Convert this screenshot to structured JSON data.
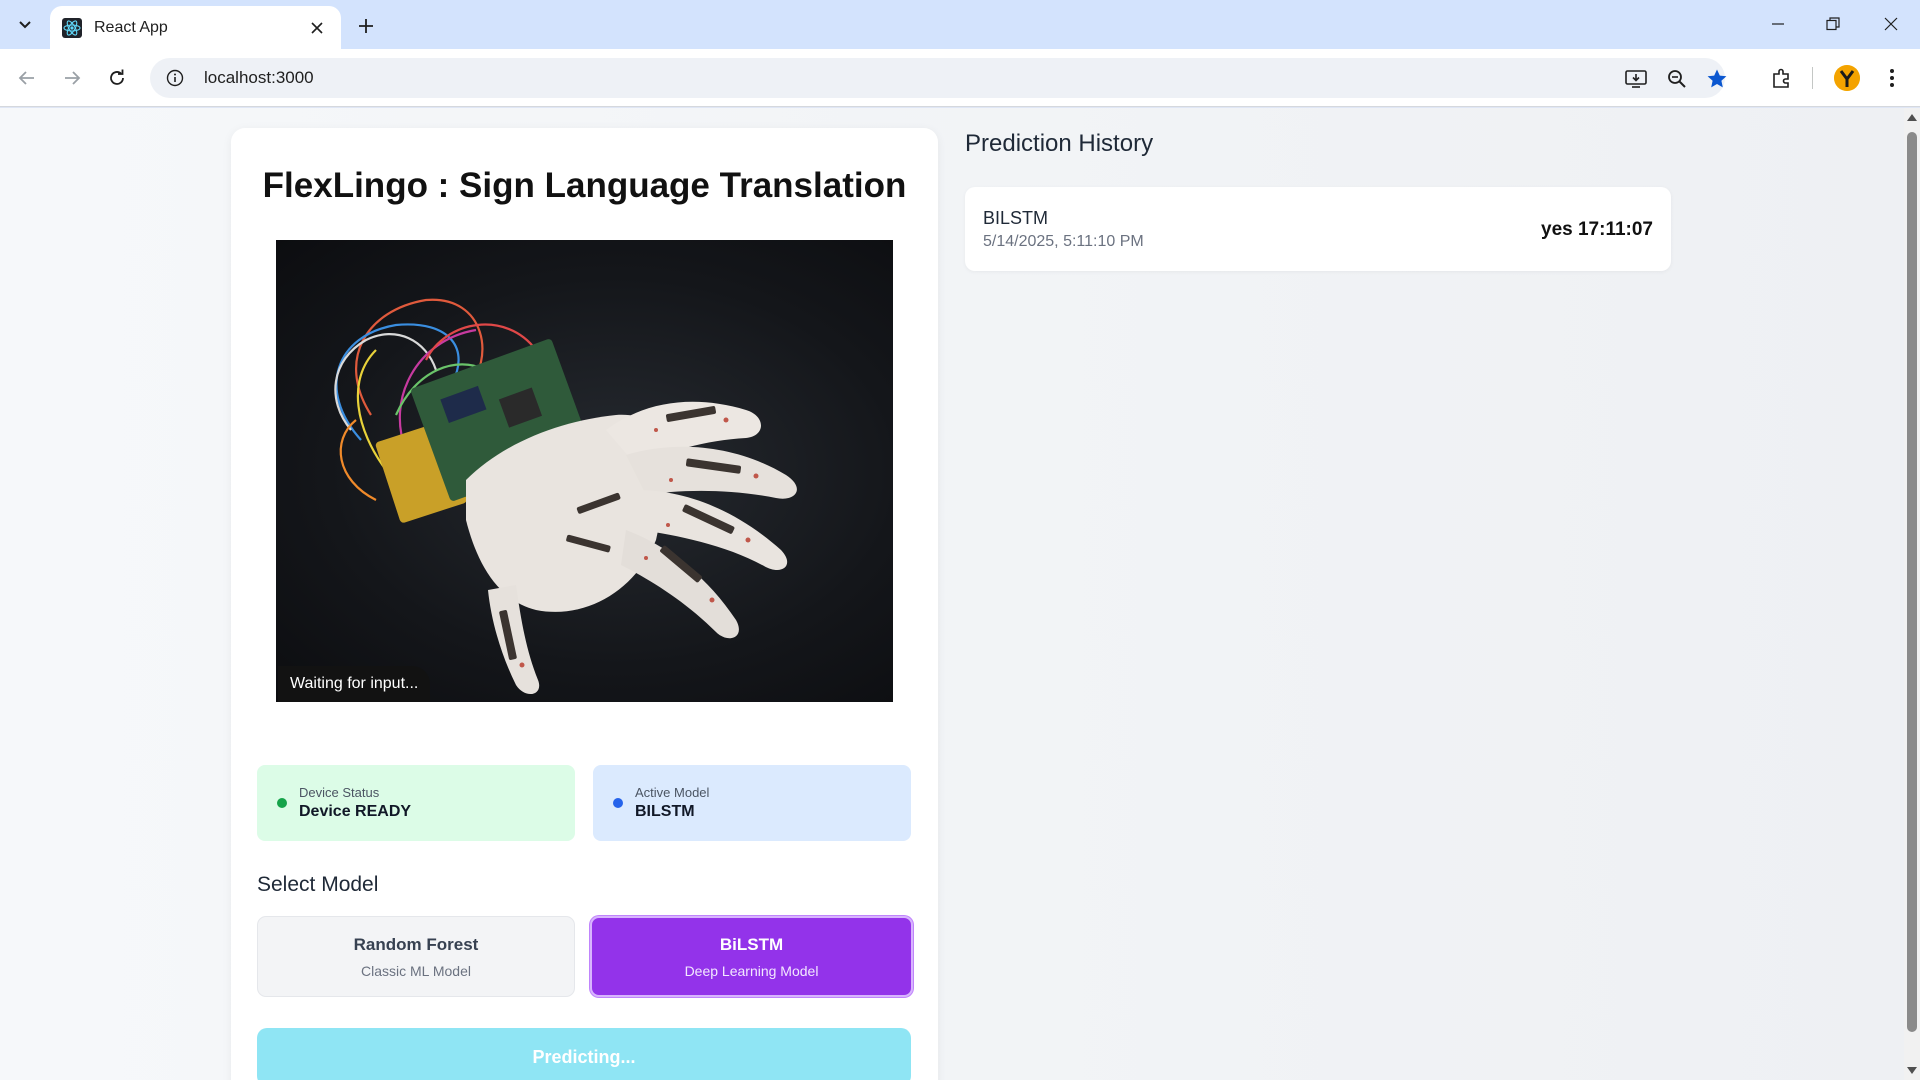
{
  "browser": {
    "tab_title": "React App",
    "url": "localhost:3000"
  },
  "app": {
    "title": "FlexLingo : Sign Language Translation",
    "image_status": "Waiting for input...",
    "device_status": {
      "label": "Device Status",
      "value": "Device READY",
      "color": "#16a34a"
    },
    "active_model": {
      "label": "Active Model",
      "value": "BILSTM",
      "color": "#2563eb"
    },
    "select_model_title": "Select Model",
    "models": [
      {
        "name": "Random Forest",
        "desc": "Classic ML Model",
        "selected": false
      },
      {
        "name": "BiLSTM",
        "desc": "Deep Learning Model",
        "selected": true
      }
    ],
    "predict_button": "Predicting..."
  },
  "history": {
    "title": "Prediction History",
    "items": [
      {
        "model": "BILSTM",
        "date": "5/14/2025, 5:11:10 PM",
        "prediction": "yes 17:11:07"
      }
    ]
  },
  "colors": {
    "accent_purple": "#9333ea",
    "status_green_bg": "#dcfce7",
    "status_blue_bg": "#dbeafe",
    "predict_button_bg": "#8fe5f4"
  }
}
